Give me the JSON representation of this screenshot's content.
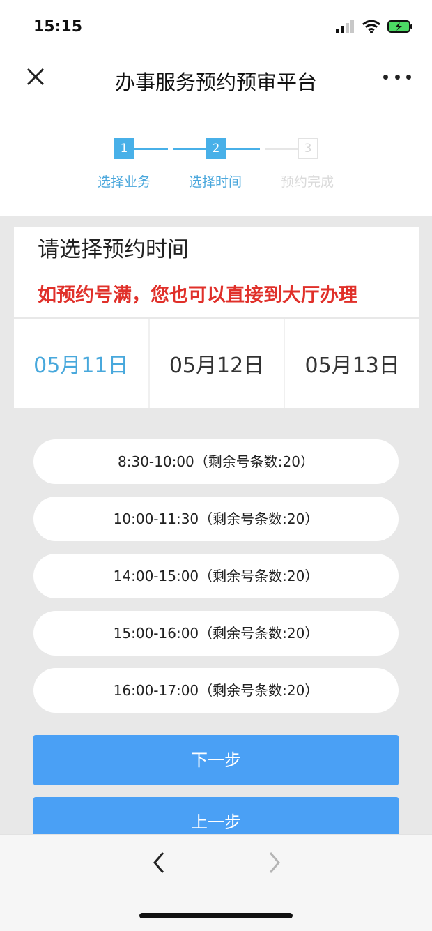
{
  "status": {
    "time": "15:15"
  },
  "nav": {
    "title": "办事服务预约预审平台"
  },
  "steps": [
    {
      "number": "1",
      "label": "选择业务",
      "state": "done"
    },
    {
      "number": "2",
      "label": "选择时间",
      "state": "current"
    },
    {
      "number": "3",
      "label": "预约完成",
      "state": "pending"
    }
  ],
  "card": {
    "title": "请选择预约时间",
    "notice": "如预约号满，您也可以直接到大厅办理",
    "dates": [
      "05月11日",
      "05月12日",
      "05月13日"
    ],
    "selected_date_index": 0
  },
  "slots": [
    "8:30-10:00（剩余号条数:20）",
    "10:00-11:30（剩余号条数:20）",
    "14:00-15:00（剩余号条数:20）",
    "15:00-16:00（剩余号条数:20）",
    "16:00-17:00（剩余号条数:20）"
  ],
  "buttons": {
    "next": "下一步",
    "prev": "上一步"
  },
  "colors": {
    "accent": "#48b0e8",
    "notice": "#e0302a",
    "button": "#4aa0f5",
    "battery": "#4cd964"
  },
  "icons": [
    "signal-icon",
    "wifi-icon",
    "battery-icon",
    "close-icon",
    "more-icon",
    "chevron-left-icon",
    "chevron-right-icon"
  ]
}
